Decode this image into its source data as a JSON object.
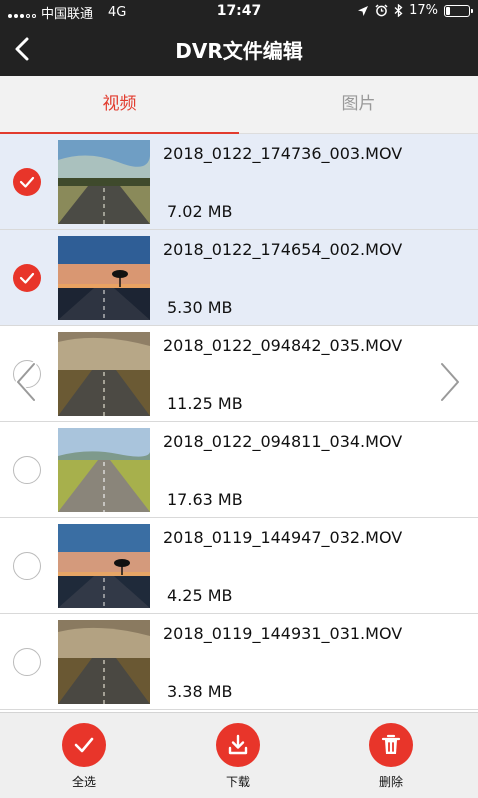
{
  "status": {
    "carrier": "中国联通",
    "network": "4G",
    "time": "17:47",
    "battery": "17%",
    "battery_level": 0.17
  },
  "header": {
    "title": "DVR文件编辑"
  },
  "tabs": [
    {
      "label": "视频",
      "active": true
    },
    {
      "label": "图片",
      "active": false
    }
  ],
  "files": [
    {
      "name": "2018_0122_174736_003.MOV",
      "size": "7.02 MB",
      "selected": true
    },
    {
      "name": "2018_0122_174654_002.MOV",
      "size": "5.30 MB",
      "selected": true
    },
    {
      "name": "2018_0122_094842_035.MOV",
      "size": "11.25 MB",
      "selected": false
    },
    {
      "name": "2018_0122_094811_034.MOV",
      "size": "17.63 MB",
      "selected": false
    },
    {
      "name": "2018_0119_144947_032.MOV",
      "size": "4.25 MB",
      "selected": false
    },
    {
      "name": "2018_0119_144931_031.MOV",
      "size": "3.38 MB",
      "selected": false
    }
  ],
  "toolbar": {
    "select_all": "全选",
    "download": "下载",
    "delete": "删除"
  },
  "colors": {
    "accent": "#e8352a",
    "header_bg": "#222222",
    "selected_row": "#e6ecf7"
  }
}
